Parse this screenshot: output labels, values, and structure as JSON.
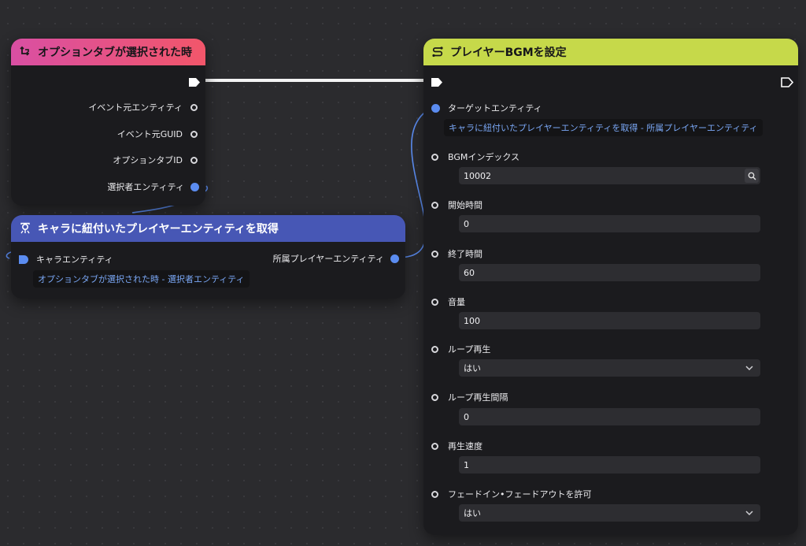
{
  "node_event": {
    "title": "オプションタブが選択された時",
    "outputs": [
      "イベント元エンティティ",
      "イベント元GUID",
      "オプションタブID",
      "選択者エンティティ"
    ]
  },
  "node_get_player": {
    "title": "キャラに紐付いたプレイヤーエンティティを取得",
    "input_label": "キャラエンティティ",
    "input_link": "オプションタブが選択された時 - 選択者エンティティ",
    "output_label": "所属プレイヤーエンティティ"
  },
  "node_set_bgm": {
    "title": "プレイヤーBGMを設定",
    "target_label": "ターゲットエンティティ",
    "target_link": "キャラに紐付いたプレイヤーエンティティを取得 - 所属プレイヤーエンティティ",
    "params": [
      {
        "label": "BGMインデックス",
        "value": "10002",
        "kind": "search"
      },
      {
        "label": "開始時間",
        "value": "0",
        "kind": "text"
      },
      {
        "label": "終了時間",
        "value": "60",
        "kind": "text"
      },
      {
        "label": "音量",
        "value": "100",
        "kind": "text"
      },
      {
        "label": "ループ再生",
        "value": "はい",
        "kind": "dropdown"
      },
      {
        "label": "ループ再生間隔",
        "value": "0",
        "kind": "text"
      },
      {
        "label": "再生速度",
        "value": "1",
        "kind": "text"
      },
      {
        "label": "フェードイン•フェードアウトを許可",
        "value": "はい",
        "kind": "dropdown"
      }
    ]
  },
  "colors": {
    "event_header_start": "#d94fa3",
    "event_header_end": "#f2566a",
    "getter_header": "#4757b5",
    "action_header": "#c6d94a",
    "wire_blue": "#5b8cf0"
  },
  "icons": {
    "event": "event-loop-icon",
    "getter": "query-player-icon",
    "action": "action-flow-icon"
  }
}
